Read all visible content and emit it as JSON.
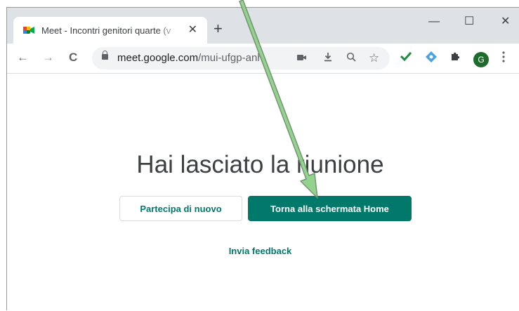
{
  "browser": {
    "tab_title": "Meet - Incontri genitori quarte (v",
    "tab_close": "✕",
    "new_tab": "+",
    "window_controls": {
      "minimize": "—",
      "maximize": "☐",
      "close": "✕"
    },
    "nav": {
      "back": "←",
      "forward": "→",
      "reload": "C"
    },
    "url_domain": "meet.google.com",
    "url_path": "/mui-ufgp-anh",
    "avatar_letter": "G",
    "icons": [
      "camera-icon",
      "download-icon",
      "zoom-icon",
      "star-icon",
      "check-extension-icon",
      "diamond-extension-icon",
      "puzzle-extensions-icon",
      "menu-kebab-icon"
    ]
  },
  "page": {
    "headline": "Hai lasciato la riunione",
    "rejoin_label": "Partecipa di nuovo",
    "home_label": "Torna alla schermata Home",
    "feedback_label": "Invia feedback"
  },
  "colors": {
    "accent": "#00796b",
    "annotation_arrow": "#8fd18a"
  }
}
